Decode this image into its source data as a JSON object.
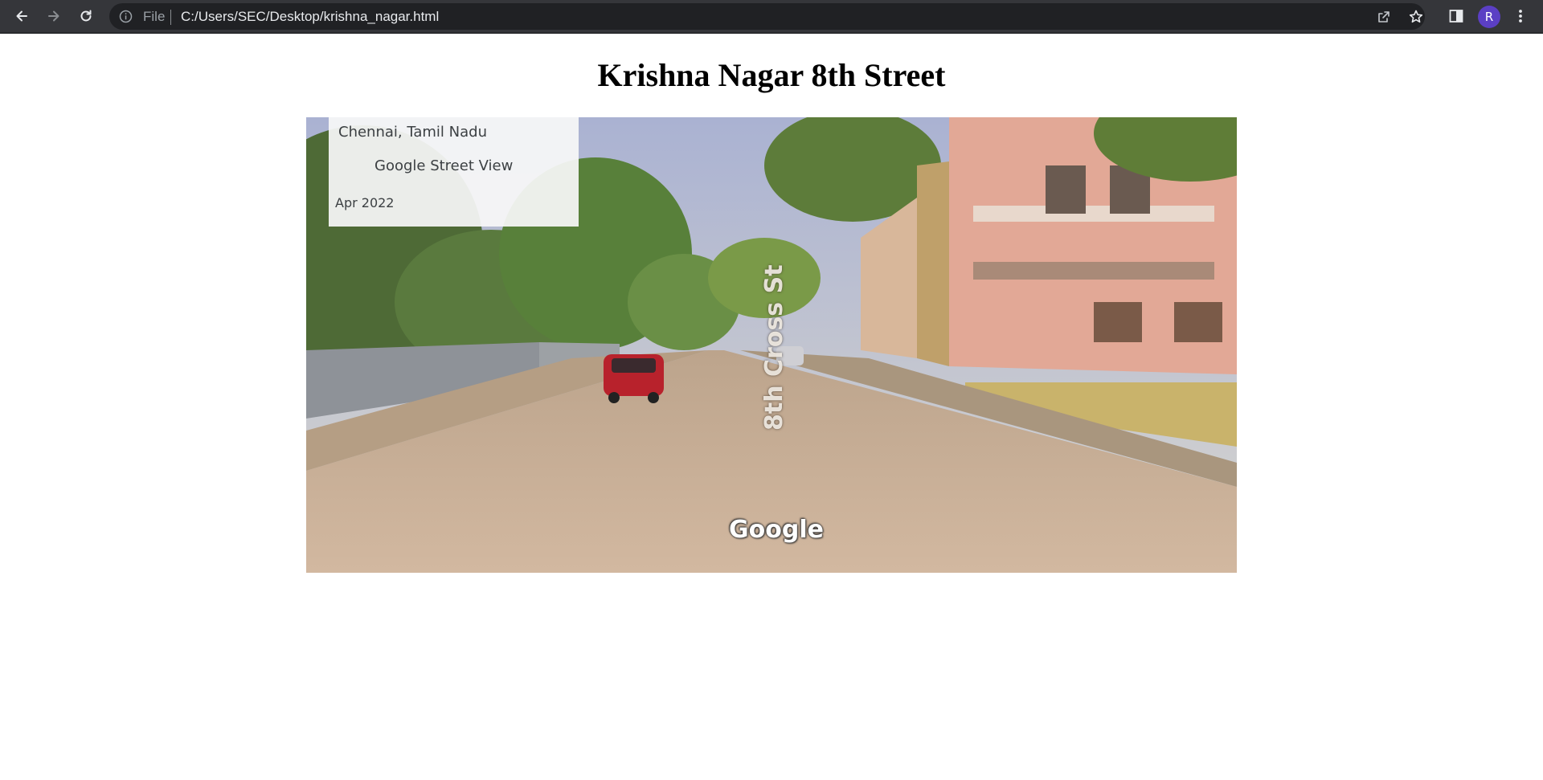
{
  "browser": {
    "url_scheme": "File",
    "url": "C:/Users/SEC/Desktop/krishna_nagar.html",
    "profile_initial": "R",
    "icons": [
      "back-arrow-icon",
      "forward-arrow-icon",
      "reload-icon",
      "info-icon",
      "share-icon",
      "bookmark-star-icon",
      "side-panel-icon",
      "menu-dots-icon"
    ]
  },
  "page": {
    "title": "Krishna Nagar 8th Street"
  },
  "streetview": {
    "location": "Chennai, Tamil Nadu",
    "provider": "Google Street View",
    "capture_date": "Apr 2022",
    "street_label": "8th Cross St",
    "watermark": "Google"
  },
  "colors": {
    "toolbar": "#35363a",
    "omnibox": "#202124",
    "avatar": "#5b3fc4",
    "sky": "#b9bfd6",
    "road": "#c4a98f"
  }
}
